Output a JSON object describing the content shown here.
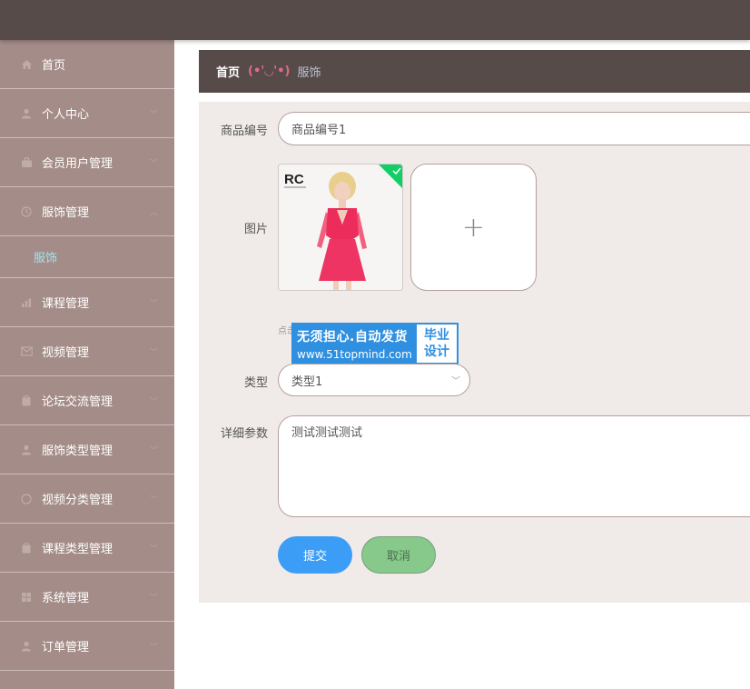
{
  "breadcrumb": {
    "home": "首页",
    "emoji": "(•'◡'•)",
    "current": "服饰"
  },
  "sidebar": {
    "items": [
      {
        "label": "首页",
        "icon": "home-icon"
      },
      {
        "label": "个人中心",
        "icon": "user-icon"
      },
      {
        "label": "会员用户管理",
        "icon": "briefcase-icon"
      },
      {
        "label": "服饰管理",
        "icon": "clock-icon",
        "sub": "服饰"
      },
      {
        "label": "课程管理",
        "icon": "chart-icon"
      },
      {
        "label": "视频管理",
        "icon": "mail-icon"
      },
      {
        "label": "论坛交流管理",
        "icon": "clipboard-icon"
      },
      {
        "label": "服饰类型管理",
        "icon": "user-icon"
      },
      {
        "label": "视频分类管理",
        "icon": "circle-icon"
      },
      {
        "label": "课程类型管理",
        "icon": "folder-icon"
      },
      {
        "label": "系统管理",
        "icon": "grid-icon"
      },
      {
        "label": "订单管理",
        "icon": "user-icon"
      }
    ]
  },
  "form": {
    "product_code_label": "商品编号",
    "product_code_value": "商品编号1",
    "image_label": "图片",
    "image_logo_text": "RC",
    "upload_plus": "+",
    "hint": "点击",
    "type_label": "类型",
    "type_value": "类型1",
    "details_label": "详细参数",
    "details_value": "测试测试测试",
    "submit_label": "提交",
    "cancel_label": "取消"
  },
  "watermark": {
    "line1": "无须担心.自动发货",
    "line2": "www.51topmind.com",
    "right_line1": "毕业",
    "right_line2": "设计"
  },
  "colors": {
    "topbar": "#574b4a",
    "sidebar": "#a48d88",
    "panel": "#f0ebe9",
    "submit": "#3c9df7",
    "cancel": "#86c98a",
    "active_sub": "#9fe3f3"
  }
}
